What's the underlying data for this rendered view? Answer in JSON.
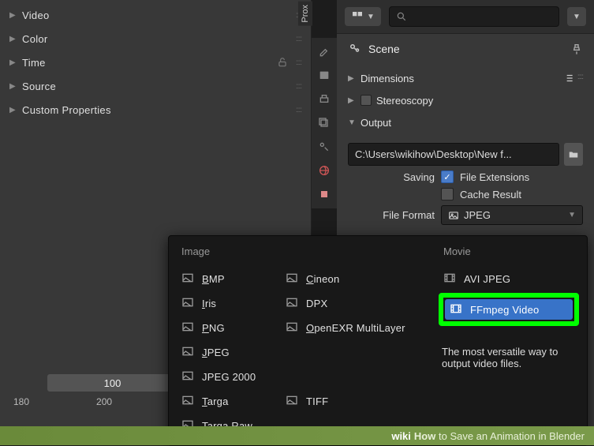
{
  "left_panel": {
    "items": [
      {
        "label": "Video",
        "locked": false
      },
      {
        "label": "Color",
        "locked": false
      },
      {
        "label": "Time",
        "locked": true
      },
      {
        "label": "Source",
        "locked": false
      },
      {
        "label": "Custom Properties",
        "locked": false
      }
    ]
  },
  "prox_label": "Prox",
  "timeline": {
    "current_frame": "100",
    "ticks": [
      "180",
      "200"
    ]
  },
  "header": {
    "search_placeholder": ""
  },
  "scene": {
    "label": "Scene"
  },
  "sections": {
    "dimensions": "Dimensions",
    "stereoscopy": "Stereoscopy",
    "output": "Output"
  },
  "output": {
    "path": "C:\\Users\\wikihow\\Desktop\\New f...",
    "saving_label": "Saving",
    "file_extensions": "File Extensions",
    "cache_result": "Cache Result",
    "file_format_label": "File Format",
    "file_format_value": "JPEG"
  },
  "popup": {
    "headers": {
      "image": "Image",
      "movie": "Movie"
    },
    "image_col1": [
      {
        "label": "BMP",
        "u": "B"
      },
      {
        "label": "Iris",
        "u": "I"
      },
      {
        "label": "PNG",
        "u": "P"
      },
      {
        "label": "JPEG",
        "u": "J"
      },
      {
        "label": "JPEG 2000"
      },
      {
        "label": "Targa",
        "u": "T"
      },
      {
        "label": "Targa Raw",
        "u": "R",
        "pos": 6
      }
    ],
    "image_col2": [
      {
        "label": "Cineon",
        "u": "C"
      },
      {
        "label": "DPX"
      },
      {
        "label": "OpenEXR MultiLayer",
        "u": "O"
      },
      {
        "label": ""
      },
      {
        "label": ""
      },
      {
        "label": "TIFF"
      }
    ],
    "movie_col": [
      {
        "label": "AVI JPEG"
      },
      {
        "label": ""
      },
      {
        "label": "FFmpeg Video",
        "highlighted": true
      }
    ],
    "tooltip": "The most versatile way to output video files."
  },
  "wiki": {
    "logo": "wiki",
    "brand": "How",
    "text": "to Save an Animation in Blender"
  }
}
